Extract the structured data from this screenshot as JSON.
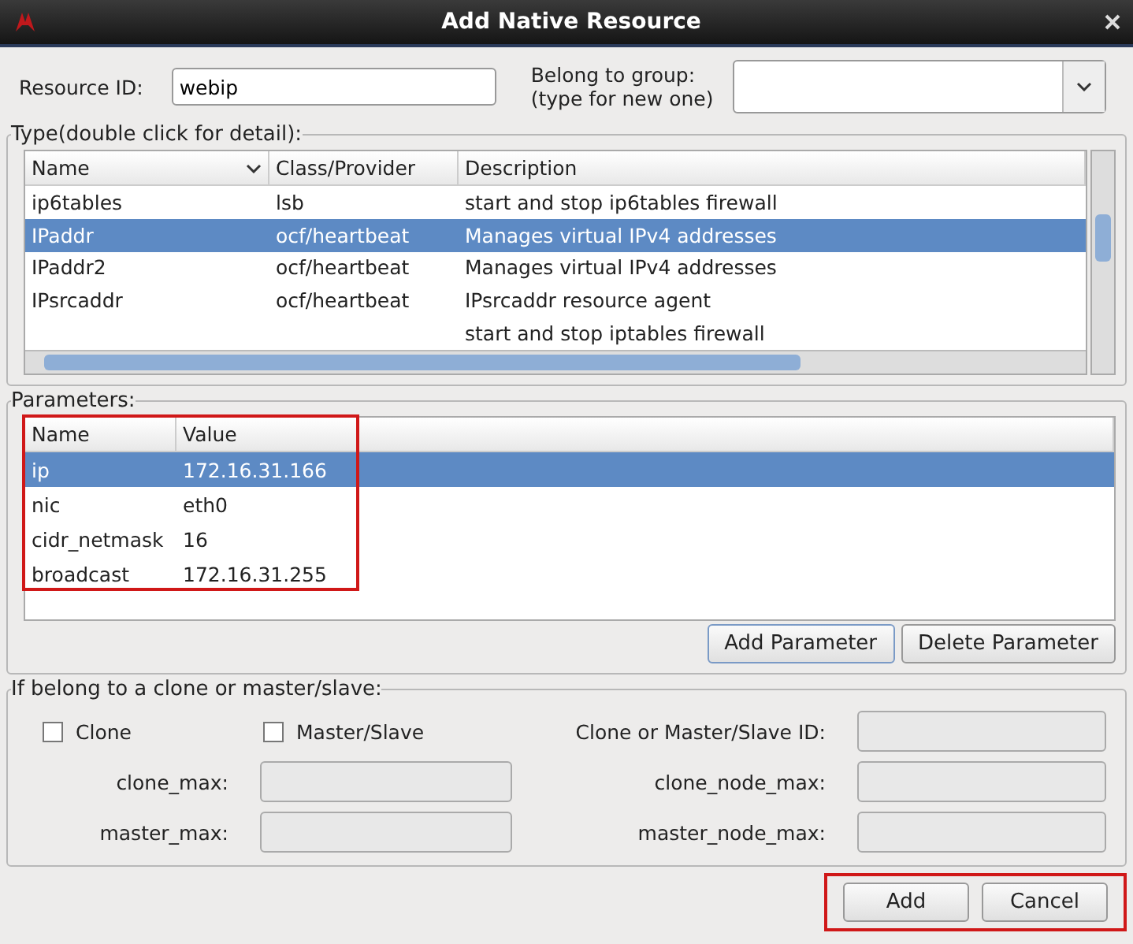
{
  "window": {
    "title": "Add Native Resource"
  },
  "resource_id": {
    "label": "Resource ID:",
    "value": "webip"
  },
  "group": {
    "label_1": "Belong to group:",
    "label_2": "(type for new one)"
  },
  "type": {
    "title": "Type(double click for detail):",
    "columns": [
      "Name",
      "Class/Provider",
      "Description"
    ],
    "rows": [
      {
        "name": "ip6tables",
        "provider": "lsb",
        "description": "start and stop ip6tables firewall",
        "selected": false
      },
      {
        "name": "IPaddr",
        "provider": "ocf/heartbeat",
        "description": "Manages virtual IPv4 addresses",
        "selected": true
      },
      {
        "name": "IPaddr2",
        "provider": "ocf/heartbeat",
        "description": "Manages virtual IPv4 addresses",
        "selected": false
      },
      {
        "name": "IPsrcaddr",
        "provider": "ocf/heartbeat",
        "description": "IPsrcaddr resource agent",
        "selected": false
      },
      {
        "name": "",
        "provider": "",
        "description": "start and stop iptables firewall",
        "selected": false
      }
    ]
  },
  "parameters": {
    "title": "Parameters:",
    "highlighted": true,
    "columns": [
      "Name",
      "Value"
    ],
    "rows": [
      {
        "name": "ip",
        "value": "172.16.31.166",
        "selected": true
      },
      {
        "name": "nic",
        "value": "eth0",
        "selected": false
      },
      {
        "name": "cidr_netmask",
        "value": "16",
        "selected": false
      },
      {
        "name": "broadcast",
        "value": "172.16.31.255",
        "selected": false
      }
    ],
    "buttons": [
      "Add Parameter",
      "Delete Parameter"
    ]
  },
  "clone": {
    "title": "If belong to a clone or master/slave:",
    "checkboxes": [
      {
        "label": "Clone",
        "checked": false
      },
      {
        "label": "Master/Slave",
        "checked": false
      }
    ],
    "id_label": "Clone or Master/Slave ID:",
    "fields": [
      "clone_max:",
      "clone_node_max:",
      "master_max:",
      "master_node_max:"
    ]
  },
  "footer": {
    "highlighted": true,
    "buttons": [
      "Add",
      "Cancel"
    ]
  }
}
